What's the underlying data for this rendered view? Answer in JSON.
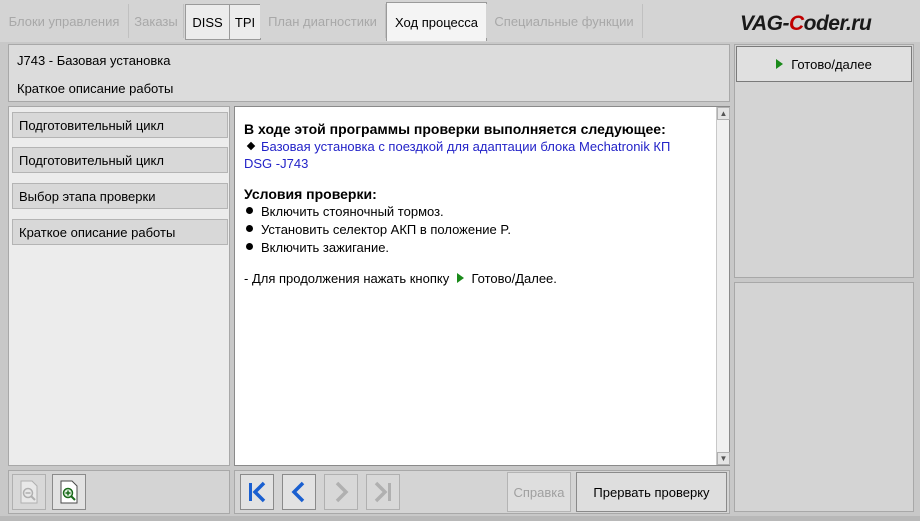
{
  "tabs": [
    {
      "label": "Блоки управления",
      "state": "disabled"
    },
    {
      "label": "Заказы",
      "state": "disabled"
    },
    {
      "label": "DISS",
      "state": "enabled"
    },
    {
      "label": "TPI",
      "state": "enabled"
    },
    {
      "label": "План диагностики",
      "state": "disabled"
    },
    {
      "label": "Ход процесса",
      "state": "active"
    },
    {
      "label": "Специальные функции",
      "state": "disabled"
    }
  ],
  "watermark": {
    "part1": "VAG-",
    "part2": "C",
    "part3": "oder.ru",
    "accent": "#c00000"
  },
  "header": {
    "title": "J743 - Базовая установка",
    "subtitle": "Краткое описание работы"
  },
  "right_panel": {
    "ready_label": "Готово/далее",
    "play_icon": "play-icon",
    "play_color": "#1a8a1a"
  },
  "nav": {
    "items": [
      {
        "label": "Подготовительный цикл"
      },
      {
        "label": "Подготовительный цикл"
      },
      {
        "label": "Выбор этапа проверки"
      },
      {
        "label": "Краткое описание работы"
      }
    ]
  },
  "content": {
    "heading": "В ходе этой программы проверки выполняется следующее:",
    "program_line1": "Базовая установка с поездкой для адаптации блока Mechatronik КП",
    "program_line2": "DSG -J743",
    "conditions_heading": "Условия проверки:",
    "conditions": [
      "Включить стояночный тормоз.",
      "Установить селектор АКП в положение P.",
      "Включить зажигание."
    ],
    "continue_text": "- Для продолжения нажать кнопку",
    "continue_button_ref": "Готово/Далее."
  },
  "toolbar": {
    "help_label": "Справка",
    "abort_label": "Прервать проверку"
  },
  "colors": {
    "link_blue": "#2323c8",
    "nav_arrow_blue": "#1a5fd0",
    "disabled_gray": "#a0a0a0"
  }
}
